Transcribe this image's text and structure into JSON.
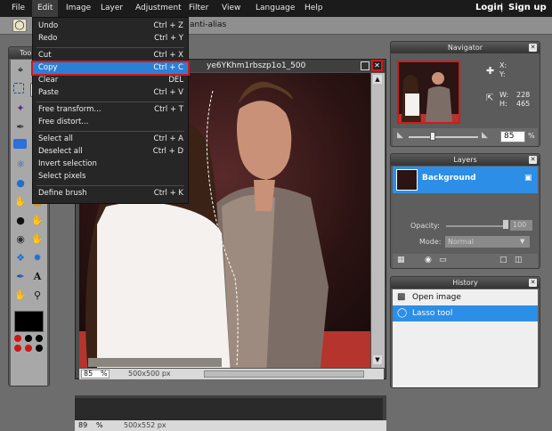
{
  "menubar": {
    "items": [
      "File",
      "Edit",
      "Image",
      "Layer",
      "Adjustment",
      "Filter",
      "View",
      "Language",
      "Help"
    ],
    "login": "Login",
    "divider": "|",
    "signup": "Sign up"
  },
  "options": {
    "antialias_label": "anti-alias"
  },
  "toolbox": {
    "title": "Toolbox",
    "tools": [
      "crop-icon",
      "move-icon",
      "marquee-icon",
      "lasso-icon",
      "wand-icon",
      "pencil-icon",
      "brush-icon",
      "eraser-icon",
      "gradient-icon",
      "bucket-icon",
      "clone-icon",
      "color-replace-icon",
      "drop-icon",
      "triangle-icon",
      "smudge-icon",
      "sponge-icon",
      "burn-icon",
      "dodge-icon",
      "eye-icon",
      "pinch-icon",
      "bloat-icon",
      "spherize-icon",
      "picker-icon",
      "text-icon",
      "hand-icon",
      "zoom-icon"
    ]
  },
  "edit_menu": {
    "items": [
      {
        "label": "Undo",
        "shortcut": "Ctrl + Z"
      },
      {
        "label": "Redo",
        "shortcut": "Ctrl + Y"
      },
      {
        "label": "Cut",
        "shortcut": "Ctrl + X"
      },
      {
        "label": "Copy",
        "shortcut": "Ctrl + C"
      },
      {
        "label": "Clear",
        "shortcut": "DEL"
      },
      {
        "label": "Paste",
        "shortcut": "Ctrl + V"
      },
      {
        "label": "Free transform...",
        "shortcut": "Ctrl + T"
      },
      {
        "label": "Free distort...",
        "shortcut": ""
      },
      {
        "label": "Select all",
        "shortcut": "Ctrl + A"
      },
      {
        "label": "Deselect all",
        "shortcut": "Ctrl + D"
      },
      {
        "label": "Invert selection",
        "shortcut": ""
      },
      {
        "label": "Select pixels",
        "shortcut": ""
      },
      {
        "label": "Define brush",
        "shortcut": "Ctrl + K"
      }
    ]
  },
  "image_window": {
    "title": "ye6YKhm1rbszp1o1_500",
    "zoom": "85",
    "zoom_unit": "%",
    "size": "500x500 px"
  },
  "bottom_status": {
    "zoom": "89",
    "zoom_unit": "%",
    "size": "500x552 px"
  },
  "navigator": {
    "title": "Navigator",
    "x_label": "X:",
    "y_label": "Y:",
    "w_label": "W:",
    "w_value": "228",
    "h_label": "H:",
    "h_value": "465",
    "zoom": "85",
    "zoom_unit": "%",
    "slider_level": 0.35
  },
  "layers": {
    "title": "Layers",
    "layer_name": "Background",
    "opacity_label": "Opacity:",
    "opacity_value": "100",
    "mode_label": "Mode:",
    "mode_value": "Normal"
  },
  "history": {
    "title": "History",
    "items": [
      "Open image",
      "Lasso tool"
    ]
  },
  "colors": {
    "accent": "#2c7fd6",
    "highlight_border": "#d21a1a",
    "foreground": "#000000",
    "background": "#ffffff"
  }
}
